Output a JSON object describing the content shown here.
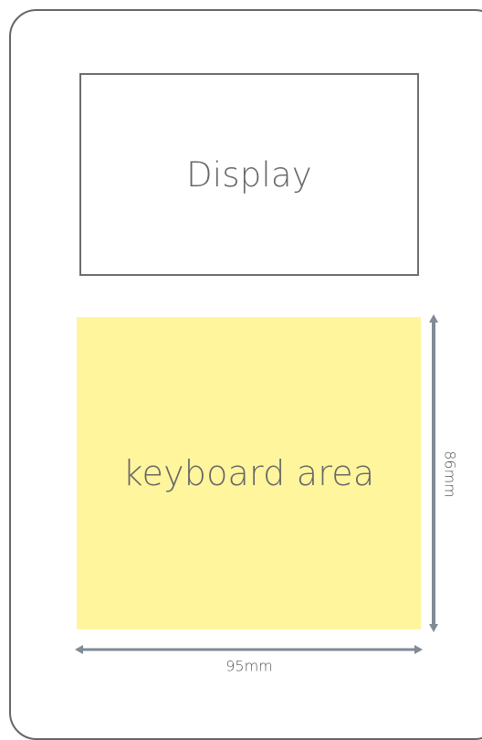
{
  "labels": {
    "display": "Display",
    "keyboard": "keyboard area"
  },
  "dimensions": {
    "width": "95mm",
    "height": "86mm"
  },
  "colors": {
    "outline": "#666666",
    "display_border": "#6d6d6d",
    "keyboard_fill": "#fff59d",
    "arrow": "#7f8b96",
    "text": "#666666"
  }
}
